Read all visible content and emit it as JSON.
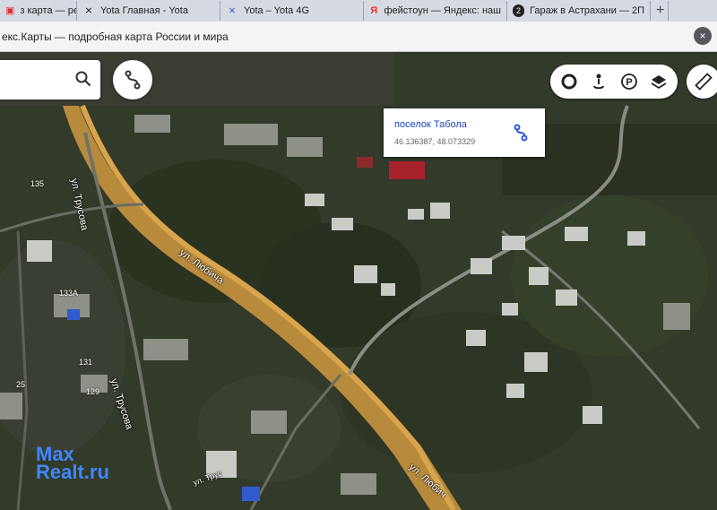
{
  "browser": {
    "tabs": [
      {
        "label": "з карта — реда",
        "icon": "yandex-doc-icon"
      },
      {
        "label": "Yota Главная - Yota",
        "icon": "yota-icon"
      },
      {
        "label": "Yota – Yota 4G",
        "icon": "yota-icon"
      },
      {
        "label": "фейстоун — Яндекс: наш",
        "icon": "yandex-icon"
      },
      {
        "label": "Гараж в Астрахани — 2П",
        "icon": "2gis-icon"
      }
    ],
    "new_tab_label": "+",
    "window_title": "екс.Карты — подробная карта России и мира",
    "close_label": "×"
  },
  "map": {
    "popup": {
      "place_name": "поселок Табола",
      "coords": "46.136387, 48.073329"
    },
    "streets": [
      {
        "name": "ул. Трусова"
      },
      {
        "name": "ул. Любича"
      },
      {
        "name": "ул. Трусова"
      },
      {
        "name": "ул. Любич"
      },
      {
        "name": "ул. Трус"
      }
    ],
    "house_numbers": [
      "135",
      "133А",
      "131",
      "129",
      "25"
    ],
    "controls": [
      "traffic-icon",
      "panorama-icon",
      "parking-icon",
      "layers-icon"
    ]
  },
  "watermark": {
    "line1": "Max",
    "line2": "Realt.ru"
  }
}
